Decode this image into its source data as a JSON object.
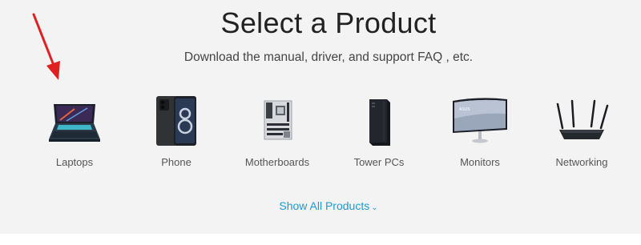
{
  "header": {
    "title": "Select a Product",
    "subtitle": "Download the manual, driver, and support FAQ , etc."
  },
  "products": [
    {
      "label": "Laptops",
      "icon": "laptop-icon"
    },
    {
      "label": "Phone",
      "icon": "phone-icon"
    },
    {
      "label": "Motherboards",
      "icon": "motherboard-icon"
    },
    {
      "label": "Tower PCs",
      "icon": "tower-pc-icon"
    },
    {
      "label": "Monitors",
      "icon": "monitor-icon"
    },
    {
      "label": "Networking",
      "icon": "router-icon"
    }
  ],
  "footer": {
    "show_all_label": "Show All Products",
    "chevron_icon": "chevron-down-icon"
  },
  "colors": {
    "panel_bg": "#f3f3f3",
    "link": "#1a9bd7",
    "annotation_arrow": "#e02020"
  }
}
